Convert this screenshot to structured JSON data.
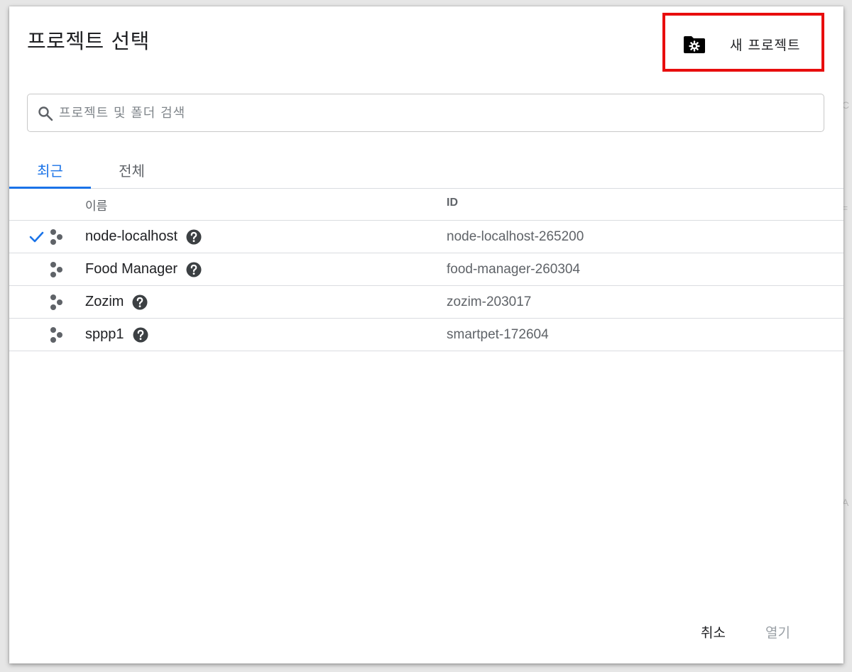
{
  "dialog": {
    "title": "프로젝트 선택",
    "new_project_label": "새 프로젝트",
    "highlight_color": "#e80d0d"
  },
  "search": {
    "placeholder": "프로젝트 및 폴더 검색",
    "value": ""
  },
  "tabs": [
    {
      "label": "최근",
      "active": true
    },
    {
      "label": "전체",
      "active": false
    }
  ],
  "table": {
    "headers": {
      "name": "이름",
      "id": "ID"
    },
    "rows": [
      {
        "name": "node-localhost",
        "id": "node-localhost-265200",
        "selected": true
      },
      {
        "name": "Food Manager",
        "id": "food-manager-260304",
        "selected": false
      },
      {
        "name": "Zozim",
        "id": "zozim-203017",
        "selected": false
      },
      {
        "name": "sppp1",
        "id": "smartpet-172604",
        "selected": false
      }
    ]
  },
  "actions": {
    "cancel_label": "취소",
    "open_label": "열기"
  },
  "colors": {
    "accent": "#1a73e8",
    "text_primary": "#202124",
    "text_secondary": "#5f6368",
    "disabled": "#9aa0a6"
  },
  "icons": {
    "new_project": "folder-gear-icon",
    "search": "search-icon",
    "selected": "check-icon",
    "project": "project-nodes-icon",
    "help": "help-circle-icon"
  }
}
